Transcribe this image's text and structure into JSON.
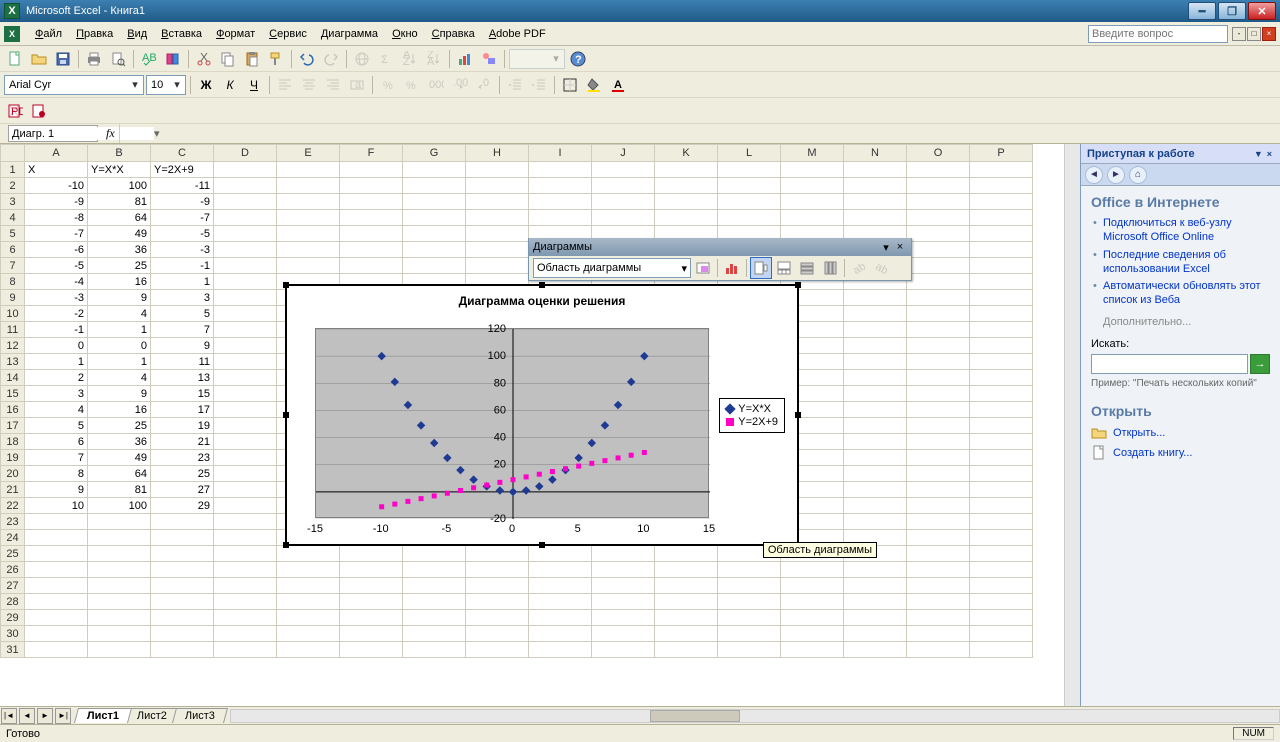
{
  "title": "Microsoft Excel - Книга1",
  "menu": [
    "Файл",
    "Правка",
    "Вид",
    "Вставка",
    "Формат",
    "Сервис",
    "Диаграмма",
    "Окно",
    "Справка",
    "Adobe PDF"
  ],
  "askbox_placeholder": "Введите вопрос",
  "font_name": "Arial Cyr",
  "font_size": "10",
  "namebox": "Диагр. 1",
  "columns": [
    "A",
    "B",
    "C",
    "D",
    "E",
    "F",
    "G",
    "H",
    "I",
    "J",
    "K",
    "L",
    "M",
    "N",
    "O",
    "P"
  ],
  "headers": {
    "A": "X",
    "B": "Y=X*X",
    "C": "Y=2X+9"
  },
  "row_count_visible": 31,
  "data_rows": [
    {
      "r": 2,
      "A": -10,
      "B": 100,
      "C": -11
    },
    {
      "r": 3,
      "A": -9,
      "B": 81,
      "C": -9
    },
    {
      "r": 4,
      "A": -8,
      "B": 64,
      "C": -7
    },
    {
      "r": 5,
      "A": -7,
      "B": 49,
      "C": -5
    },
    {
      "r": 6,
      "A": -6,
      "B": 36,
      "C": -3
    },
    {
      "r": 7,
      "A": -5,
      "B": 25,
      "C": -1
    },
    {
      "r": 8,
      "A": -4,
      "B": 16,
      "C": 1
    },
    {
      "r": 9,
      "A": -3,
      "B": 9,
      "C": 3
    },
    {
      "r": 10,
      "A": -2,
      "B": 4,
      "C": 5
    },
    {
      "r": 11,
      "A": -1,
      "B": 1,
      "C": 7
    },
    {
      "r": 12,
      "A": 0,
      "B": 0,
      "C": 9
    },
    {
      "r": 13,
      "A": 1,
      "B": 1,
      "C": 11
    },
    {
      "r": 14,
      "A": 2,
      "B": 4,
      "C": 13
    },
    {
      "r": 15,
      "A": 3,
      "B": 9,
      "C": 15
    },
    {
      "r": 16,
      "A": 4,
      "B": 16,
      "C": 17
    },
    {
      "r": 17,
      "A": 5,
      "B": 25,
      "C": 19
    },
    {
      "r": 18,
      "A": 6,
      "B": 36,
      "C": 21
    },
    {
      "r": 19,
      "A": 7,
      "B": 49,
      "C": 23
    },
    {
      "r": 20,
      "A": 8,
      "B": 64,
      "C": 25
    },
    {
      "r": 21,
      "A": 9,
      "B": 81,
      "C": 27
    },
    {
      "r": 22,
      "A": 10,
      "B": 100,
      "C": 29
    }
  ],
  "chart_toolbar": {
    "title": "Диаграммы",
    "combo": "Область диаграммы"
  },
  "chart_tooltip": "Область диаграммы",
  "chart_data": {
    "type": "scatter",
    "title": "Диаграмма оценки решения",
    "x": [
      -10,
      -9,
      -8,
      -7,
      -6,
      -5,
      -4,
      -3,
      -2,
      -1,
      0,
      1,
      2,
      3,
      4,
      5,
      6,
      7,
      8,
      9,
      10
    ],
    "series": [
      {
        "name": "Y=X*X",
        "color": "#1f3a93",
        "marker": "diamond",
        "values": [
          100,
          81,
          64,
          49,
          36,
          25,
          16,
          9,
          4,
          1,
          0,
          1,
          4,
          9,
          16,
          25,
          36,
          49,
          64,
          81,
          100
        ]
      },
      {
        "name": "Y=2X+9",
        "color": "#ff00c8",
        "marker": "square",
        "values": [
          -11,
          -9,
          -7,
          -5,
          -3,
          -1,
          1,
          3,
          5,
          7,
          9,
          11,
          13,
          15,
          17,
          19,
          21,
          23,
          25,
          27,
          29
        ]
      }
    ],
    "xlim": [
      -15,
      15
    ],
    "ylim": [
      -20,
      120
    ],
    "xticks": [
      -15,
      -10,
      -5,
      0,
      5,
      10,
      15
    ],
    "yticks": [
      -20,
      0,
      20,
      40,
      60,
      80,
      100,
      120
    ],
    "legend_position": "right"
  },
  "taskpane": {
    "title": "Приступая к работе",
    "section1": "Office в Интернете",
    "links": [
      "Подключиться к веб-узлу Microsoft Office Online",
      "Последние сведения об использовании Excel",
      "Автоматически обновлять этот список из Веба"
    ],
    "more": "Дополнительно...",
    "search_label": "Искать:",
    "example": "Пример: \"Печать нескольких копий\"",
    "section2": "Открыть",
    "open": "Открыть...",
    "newbook": "Создать книгу..."
  },
  "sheets": [
    "Лист1",
    "Лист2",
    "Лист3"
  ],
  "status": "Готово",
  "numlock": "NUM"
}
